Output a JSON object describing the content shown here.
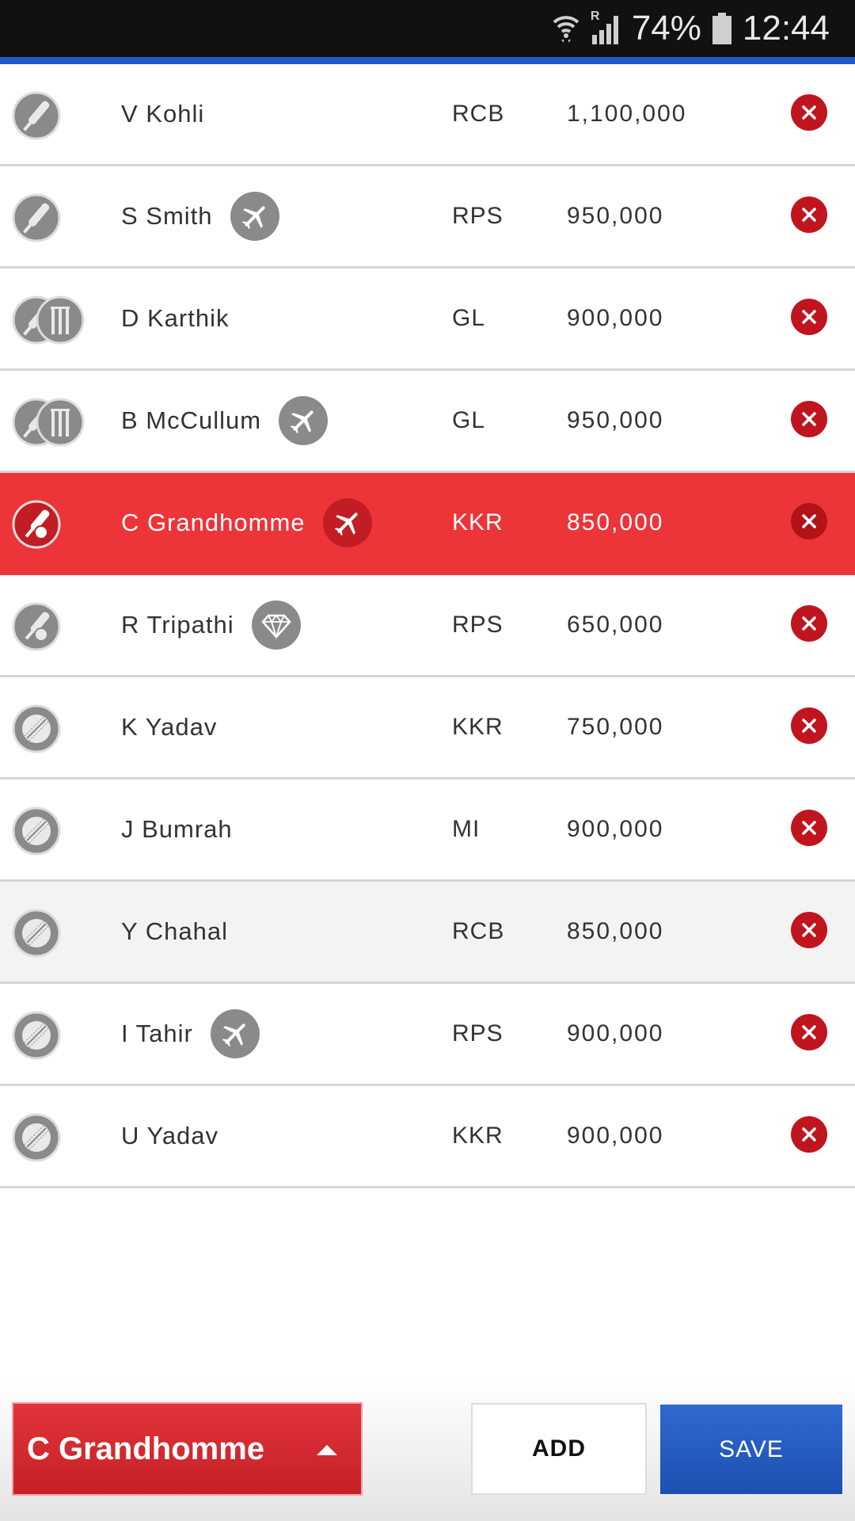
{
  "status_bar": {
    "battery": "74%",
    "time": "12:44",
    "network_tag": "R",
    "icons": [
      "wifi-icon",
      "signal-icon",
      "battery-icon"
    ]
  },
  "players": [
    {
      "name": "V Kohli",
      "team": "RCB",
      "price": "1,100,000",
      "role": "batsman",
      "badge": null,
      "state": "normal"
    },
    {
      "name": "S Smith",
      "team": "RPS",
      "price": "950,000",
      "role": "batsman",
      "badge": "overseas",
      "state": "normal"
    },
    {
      "name": "D Karthik",
      "team": "GL",
      "price": "900,000",
      "role": "wicketkeeper",
      "badge": null,
      "state": "normal"
    },
    {
      "name": "B McCullum",
      "team": "GL",
      "price": "950,000",
      "role": "wicketkeeper",
      "badge": "overseas",
      "state": "normal"
    },
    {
      "name": "C Grandhomme",
      "team": "KKR",
      "price": "850,000",
      "role": "allrounder",
      "badge": "overseas",
      "state": "selected"
    },
    {
      "name": "R Tripathi",
      "team": "RPS",
      "price": "650,000",
      "role": "allrounder",
      "badge": "uncapped",
      "state": "normal"
    },
    {
      "name": "K Yadav",
      "team": "KKR",
      "price": "750,000",
      "role": "bowler",
      "badge": null,
      "state": "normal"
    },
    {
      "name": "J Bumrah",
      "team": "MI",
      "price": "900,000",
      "role": "bowler",
      "badge": null,
      "state": "normal"
    },
    {
      "name": "Y Chahal",
      "team": "RCB",
      "price": "850,000",
      "role": "bowler",
      "badge": null,
      "state": "shaded"
    },
    {
      "name": "I Tahir",
      "team": "RPS",
      "price": "900,000",
      "role": "bowler",
      "badge": "overseas",
      "state": "normal"
    },
    {
      "name": "U Yadav",
      "team": "KKR",
      "price": "900,000",
      "role": "bowler",
      "badge": null,
      "state": "normal"
    }
  ],
  "footer": {
    "selected_player": "C Grandhomme",
    "add_label": "ADD",
    "save_label": "SAVE"
  },
  "colors": {
    "accent_red": "#ec3439",
    "remove_red": "#c0151e",
    "save_blue": "#1e5bc6",
    "icon_grey": "#8a8a8a"
  }
}
